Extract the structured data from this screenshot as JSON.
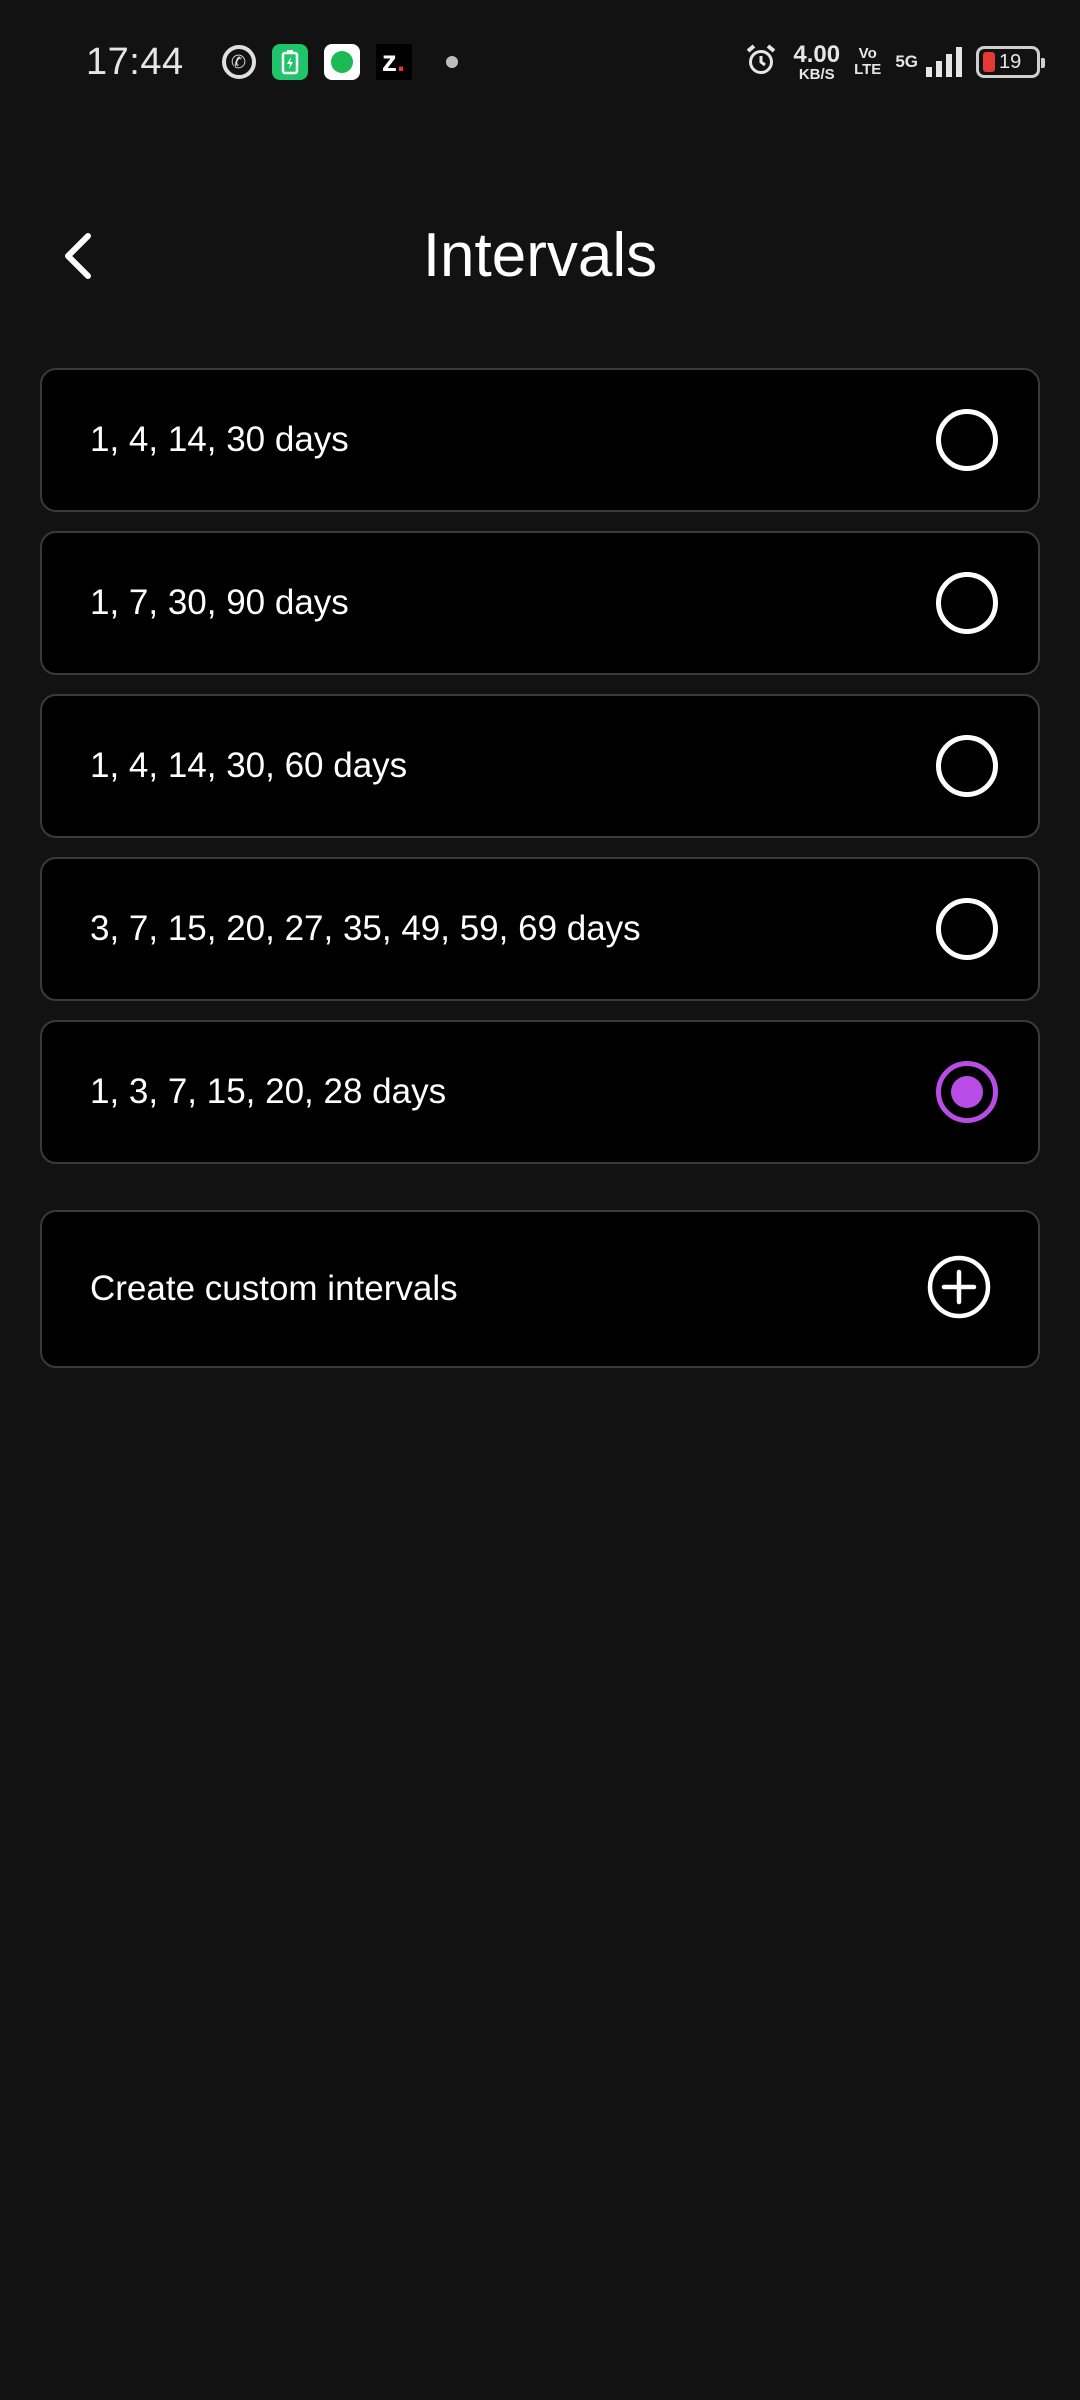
{
  "status_bar": {
    "time": "17:44",
    "net_speed_value": "4.00",
    "net_speed_unit": "KB/S",
    "volte_top": "Vo",
    "volte_bottom": "LTE",
    "network": "5G",
    "battery_percent": "19"
  },
  "header": {
    "title": "Intervals"
  },
  "options": [
    {
      "label": "1, 4, 14, 30 days",
      "selected": false
    },
    {
      "label": "1, 7, 30, 90 days",
      "selected": false
    },
    {
      "label": "1, 4, 14, 30, 60 days",
      "selected": false
    },
    {
      "label": "3, 7, 15, 20, 27, 35, 49, 59, 69 days",
      "selected": false
    },
    {
      "label": "1, 3, 7, 15, 20, 28 days",
      "selected": true
    }
  ],
  "custom": {
    "label": "Create custom intervals"
  },
  "colors": {
    "accent": "#b84de6",
    "background": "#121212",
    "card": "#000000",
    "card_border": "#3a3a3a"
  }
}
